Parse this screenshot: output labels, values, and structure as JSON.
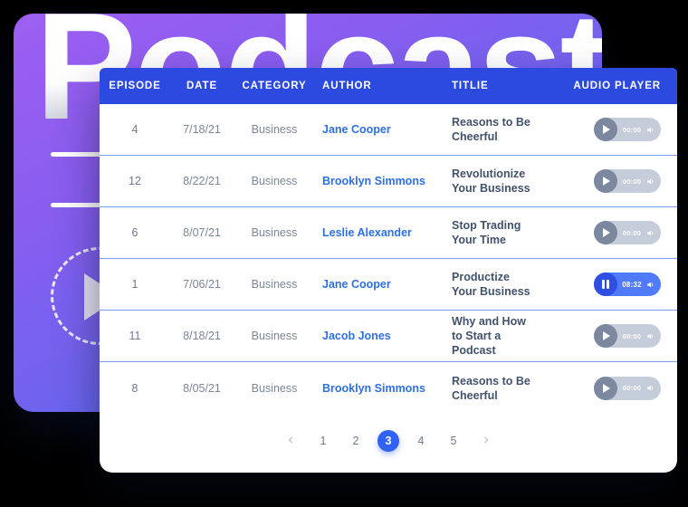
{
  "hero": {
    "title": "Podcast",
    "play_icon": "play-triangle-icon",
    "ring_icon": "dashed-circle-icon",
    "gradient_from": "#9d5ff1",
    "gradient_to": "#4572f8"
  },
  "table": {
    "accent_header_color": "#2d4ae0",
    "row_divider_color": "#7f9ceb",
    "columns": [
      "EPISODE",
      "DATE",
      "CATEGORY",
      "AUTHOR",
      "TITLIE",
      "AUDIO PLAYER"
    ],
    "rows": [
      {
        "episode": "4",
        "date": "7/18/21",
        "category": "Business",
        "author": "Jane Cooper",
        "title": "Reasons to Be Cheerful",
        "player": {
          "state": "paused",
          "time": "00:00",
          "icon": "play-icon"
        }
      },
      {
        "episode": "12",
        "date": "8/22/21",
        "category": "Business",
        "author": "Brooklyn Simmons",
        "title": "Revolutionize Your Business",
        "player": {
          "state": "paused",
          "time": "00:00",
          "icon": "play-icon"
        }
      },
      {
        "episode": "6",
        "date": "8/07/21",
        "category": "Business",
        "author": "Leslie Alexander",
        "title": "Stop Trading Your Time",
        "player": {
          "state": "paused",
          "time": "00:00",
          "icon": "play-icon"
        }
      },
      {
        "episode": "1",
        "date": "7/06/21",
        "category": "Business",
        "author": "Jane Cooper",
        "title": "Productize Your Business",
        "player": {
          "state": "playing",
          "time": "08:32",
          "icon": "pause-icon"
        }
      },
      {
        "episode": "11",
        "date": "8/18/21",
        "category": "Business",
        "author": "Jacob Jones",
        "title": "Why and How to Start a Podcast",
        "player": {
          "state": "paused",
          "time": "00:00",
          "icon": "play-icon"
        }
      },
      {
        "episode": "8",
        "date": "8/05/21",
        "category": "Business",
        "author": "Brooklyn Simmons",
        "title": "Reasons to Be Cheerful",
        "player": {
          "state": "paused",
          "time": "00:00",
          "icon": "play-icon"
        }
      }
    ]
  },
  "pagination": {
    "prev_label": "‹",
    "next_label": "›",
    "pages": [
      "1",
      "2",
      "3",
      "4",
      "5"
    ],
    "active_page": "3",
    "active_color": "#3063f5"
  }
}
